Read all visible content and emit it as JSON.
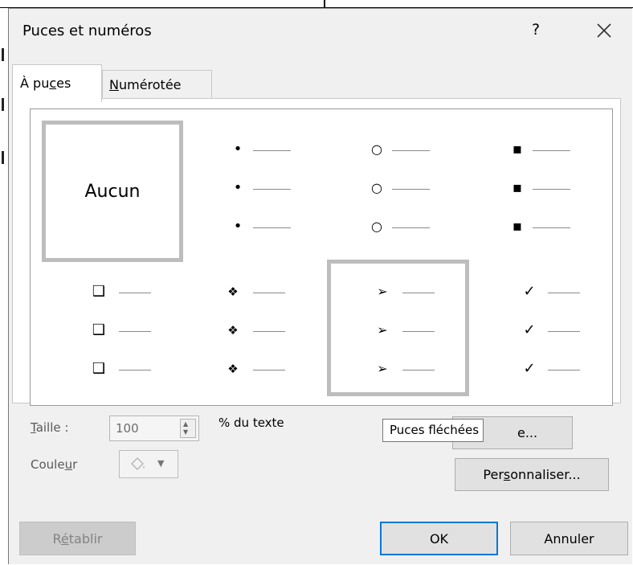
{
  "dialog": {
    "title": "Puces et numéros",
    "help_label": "?"
  },
  "tabs": [
    {
      "pre": "À pu",
      "mn": "c",
      "post": "es",
      "active": true
    },
    {
      "pre": "",
      "mn": "N",
      "post": "umérotée",
      "active": false
    }
  ],
  "bullets": {
    "none_label": "Aucun",
    "selected": "Puces fléchées",
    "cells": [
      {
        "name": "none"
      },
      {
        "name": "small-dot",
        "symbol": "•"
      },
      {
        "name": "hollow-circle",
        "symbol": "○"
      },
      {
        "name": "filled-square",
        "symbol": "▪"
      },
      {
        "name": "hollow-square",
        "symbol": "❑"
      },
      {
        "name": "four-diamond",
        "symbol": "❖"
      },
      {
        "name": "arrow",
        "symbol": "➢"
      },
      {
        "name": "checkmark",
        "symbol": "✓"
      }
    ]
  },
  "size": {
    "label_mn": "T",
    "label_rest": "aille :",
    "value": "100",
    "unit": "% du texte"
  },
  "color": {
    "label_pre": "Coule",
    "label_mn": "u",
    "label_post": "r",
    "icon": "paint-bucket-icon"
  },
  "tooltip": "Puces fléchées",
  "buttons": {
    "image_partial": "e...",
    "customize_pre": "Per",
    "customize_mn": "s",
    "customize_post": "onnaliser...",
    "reset_pre": "R",
    "reset_mn": "é",
    "reset_post": "tablir",
    "ok": "OK",
    "cancel": "Annuler"
  }
}
